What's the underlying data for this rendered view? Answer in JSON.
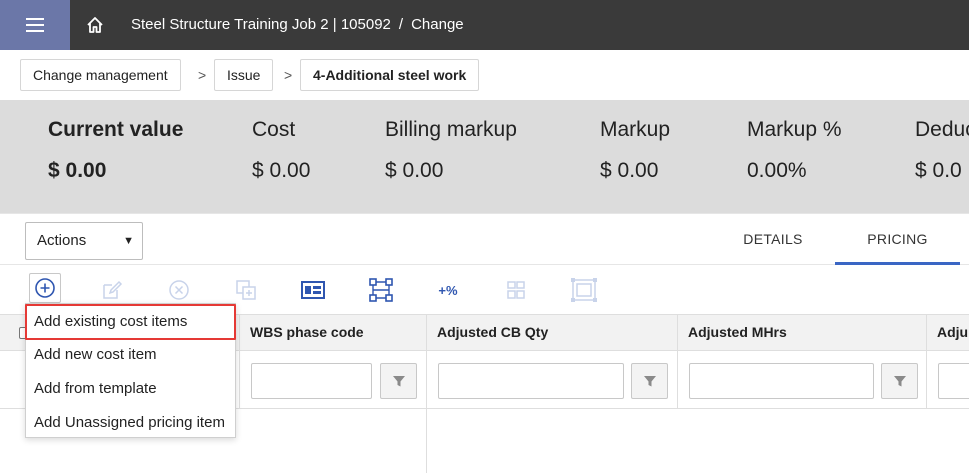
{
  "topbar": {
    "project": "Steel Structure Training Job 2 | 105092",
    "separator": "/",
    "section": "Change"
  },
  "breadcrumb": {
    "items": [
      "Change management",
      "Issue",
      "4-Additional steel work"
    ],
    "arrow": ">"
  },
  "summary": [
    {
      "label": "Current value",
      "value": "$ 0.00"
    },
    {
      "label": "Cost",
      "value": "$ 0.00"
    },
    {
      "label": "Billing markup",
      "value": "$ 0.00"
    },
    {
      "label": "Markup",
      "value": "$ 0.00"
    },
    {
      "label": "Markup %",
      "value": "0.00%"
    },
    {
      "label": "Deduc",
      "value": "$ 0.0"
    }
  ],
  "actions": {
    "label": "Actions",
    "caret": "▼"
  },
  "tabs": [
    {
      "label": "DETAILS",
      "active": false
    },
    {
      "label": "PRICING",
      "active": true
    }
  ],
  "toolbar": {
    "percent_label": "+%"
  },
  "grid": {
    "columns": [
      "WBS phase code",
      "Adjusted CB Qty",
      "Adjusted MHrs",
      "Adju"
    ]
  },
  "dropdown": {
    "items": [
      "Add existing cost items",
      "Add new cost item",
      "Add from template",
      "Add Unassigned pricing item"
    ]
  },
  "colors": {
    "topbar": "#3a3a3a",
    "menu_button": "#6b77a8",
    "summary_band": "#dcdcdc",
    "accent": "#3a66c4",
    "highlight": "#e53935"
  }
}
